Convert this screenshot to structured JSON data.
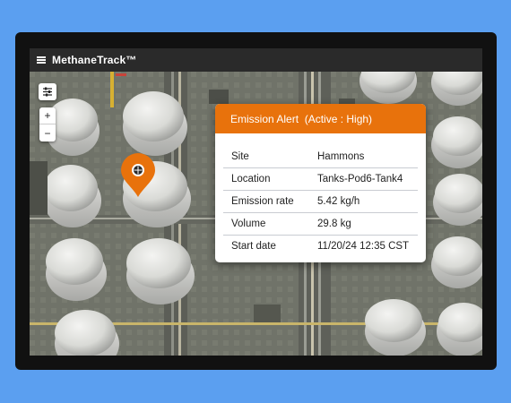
{
  "app": {
    "title": "MethaneTrack™"
  },
  "map": {
    "filter_icon": "sliders-icon",
    "zoom_in_label": "+",
    "zoom_out_label": "−",
    "marker_icon": "location-pin-icon"
  },
  "alert": {
    "title": "Emission Alert  (Active : High)",
    "status": "Active",
    "severity": "High",
    "accent_color": "#e8720c",
    "rows": [
      {
        "label": "Site",
        "value": "Hammons"
      },
      {
        "label": "Location",
        "value": "Tanks-Pod6-Tank4"
      },
      {
        "label": "Emission rate",
        "value": "5.42 kg/h"
      },
      {
        "label": "Volume",
        "value": "29.8 kg"
      },
      {
        "label": "Start date",
        "value": "11/20/24 12:35 CST"
      }
    ]
  },
  "colors": {
    "background": "#5b9ff0",
    "topbar": "#2a2a2a",
    "marker": "#e8720c"
  }
}
